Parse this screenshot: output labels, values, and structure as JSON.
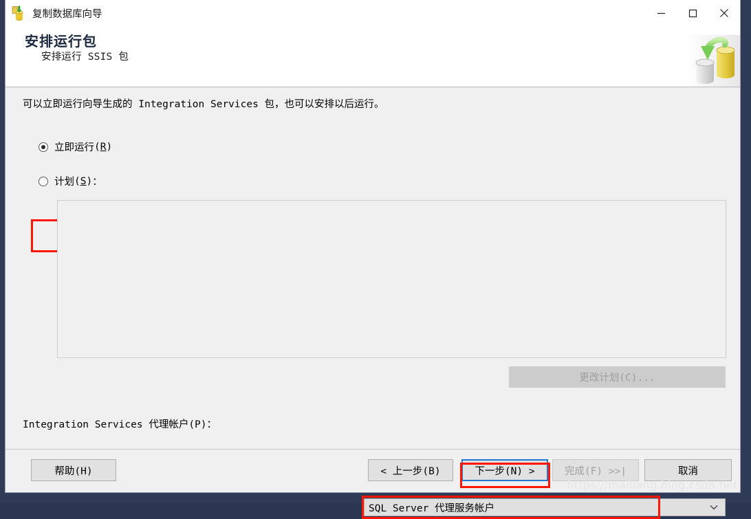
{
  "window": {
    "title": "复制数据库向导",
    "icon": "database-copy-icon",
    "controls": {
      "minimize": "minimize-icon",
      "maximize": "maximize-icon",
      "close": "close-icon"
    }
  },
  "header": {
    "title": "安排运行包",
    "subtitle": "安排运行 SSIS 包",
    "graphic": "database-transfer-graphic"
  },
  "body": {
    "intro": "可以立即运行向导生成的 Integration Services 包，也可以安排以后运行。",
    "options": [
      {
        "id": "run-now",
        "label": "立即运行",
        "accel": "R",
        "checked": true,
        "highlighted": true
      },
      {
        "id": "schedule",
        "label": "计划",
        "accel": "S",
        "checked": false,
        "highlighted": false,
        "suffix": "："
      }
    ],
    "schedule_panel": {
      "value": ""
    },
    "change_plan_button": {
      "label": "更改计划(C)...",
      "accel": "C",
      "disabled": true
    },
    "account": {
      "label": "Integration Services 代理帐户(P)：",
      "accel": "P",
      "value": "SQL Server 代理服务帐户",
      "highlighted": true,
      "arrow": "chevron-down-icon"
    }
  },
  "footer": {
    "buttons": [
      {
        "id": "help",
        "label": "帮助(H)",
        "accel": "H",
        "disabled": false,
        "focused": false,
        "highlighted": false
      },
      {
        "id": "back",
        "label": "< 上一步(B)",
        "accel": "B",
        "disabled": false,
        "focused": false,
        "highlighted": false
      },
      {
        "id": "next",
        "label": "下一步(N) >",
        "accel": "N",
        "disabled": false,
        "focused": true,
        "highlighted": true
      },
      {
        "id": "finish",
        "label": "完成(F) >>|",
        "accel": "F",
        "disabled": true,
        "focused": false,
        "highlighted": false
      },
      {
        "id": "cancel",
        "label": "取消",
        "accel": "",
        "disabled": false,
        "focused": false,
        "highlighted": false
      }
    ],
    "watermark": "https://mailiang.blog.csdn.net"
  },
  "colors": {
    "annotation_red": "#fd1703",
    "focus_blue": "#1f79d4",
    "desktop": "#2e3a56",
    "dialog_body": "#f0f0f0"
  }
}
